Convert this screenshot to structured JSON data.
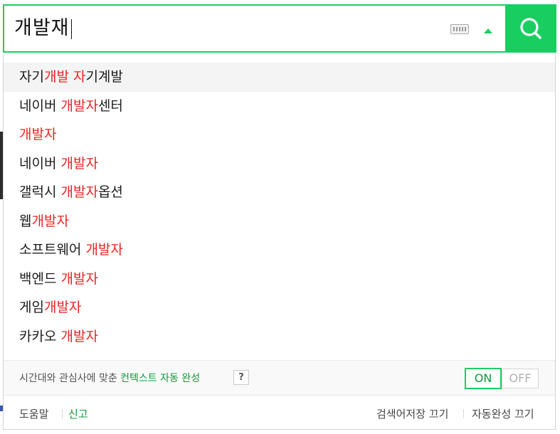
{
  "search": {
    "query": "개발재"
  },
  "suggestions": [
    [
      {
        "t": "자기",
        "h": false
      },
      {
        "t": "개발 자",
        "h": true
      },
      {
        "t": "기계발",
        "h": false
      }
    ],
    [
      {
        "t": "네이버 ",
        "h": false
      },
      {
        "t": "개발자",
        "h": true
      },
      {
        "t": "센터",
        "h": false
      }
    ],
    [
      {
        "t": "개발자",
        "h": true
      }
    ],
    [
      {
        "t": "네이버 ",
        "h": false
      },
      {
        "t": "개발자",
        "h": true
      }
    ],
    [
      {
        "t": "갤럭시 ",
        "h": false
      },
      {
        "t": "개발자",
        "h": true
      },
      {
        "t": "옵션",
        "h": false
      }
    ],
    [
      {
        "t": "웹",
        "h": false
      },
      {
        "t": "개발자",
        "h": true
      }
    ],
    [
      {
        "t": "소프트웨어 ",
        "h": false
      },
      {
        "t": "개발자",
        "h": true
      }
    ],
    [
      {
        "t": "백엔드 ",
        "h": false
      },
      {
        "t": "개발자",
        "h": true
      }
    ],
    [
      {
        "t": "게임",
        "h": false
      },
      {
        "t": "개발자",
        "h": true
      }
    ],
    [
      {
        "t": "카카오 ",
        "h": false
      },
      {
        "t": "개발자",
        "h": true
      }
    ]
  ],
  "context": {
    "text": "시간대와 관심사에 맞춘 ",
    "link": "컨텍스트 자동 완성",
    "help": "?",
    "on_label": "ON",
    "off_label": "OFF"
  },
  "footer": {
    "help": "도움말",
    "report": "신고",
    "history_off": "검색어저장 끄기",
    "autocomplete_off": "자동완성 끄기"
  },
  "colors": {
    "accent": "#19ce60",
    "highlight": "#ec2323",
    "link_green": "#0e9c3a"
  }
}
